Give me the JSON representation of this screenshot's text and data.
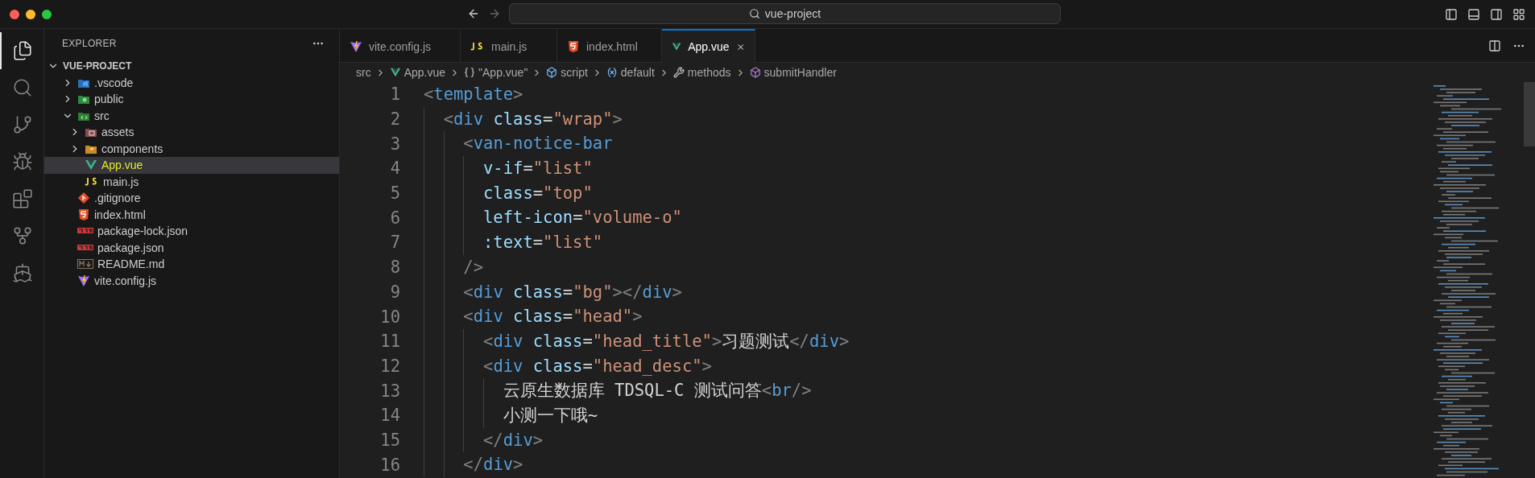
{
  "window": {
    "title": "vue-project"
  },
  "activity_bar": [
    {
      "kind": "files",
      "selected": true
    },
    {
      "kind": "search",
      "selected": false
    },
    {
      "kind": "source-control",
      "selected": false
    },
    {
      "kind": "run-debug",
      "selected": false
    },
    {
      "kind": "extensions",
      "selected": false
    },
    {
      "kind": "git-graph",
      "selected": false
    },
    {
      "kind": "docker",
      "selected": false
    }
  ],
  "sidebar": {
    "title": "EXPLORER",
    "project": {
      "label": "VUE-PROJECT",
      "expanded": true,
      "children": [
        {
          "label": ".vscode",
          "kind": "vscode-folder",
          "expanded": false,
          "selected": false
        },
        {
          "label": "public",
          "kind": "public-folder",
          "expanded": false,
          "selected": false
        },
        {
          "label": "src",
          "kind": "src-folder",
          "expanded": true,
          "selected": false,
          "children": [
            {
              "label": "assets",
              "kind": "assets-folder",
              "expanded": false,
              "selected": false
            },
            {
              "label": "components",
              "kind": "components-folder",
              "expanded": false,
              "selected": false
            },
            {
              "label": "App.vue",
              "kind": "vue",
              "selected": true
            },
            {
              "label": "main.js",
              "kind": "js",
              "selected": false
            }
          ]
        },
        {
          "label": ".gitignore",
          "kind": "git",
          "selected": false
        },
        {
          "label": "index.html",
          "kind": "html",
          "selected": false
        },
        {
          "label": "package-lock.json",
          "kind": "npm",
          "selected": false
        },
        {
          "label": "package.json",
          "kind": "npm",
          "selected": false
        },
        {
          "label": "README.md",
          "kind": "markdown",
          "selected": false
        },
        {
          "label": "vite.config.js",
          "kind": "vite",
          "selected": false
        }
      ]
    }
  },
  "tabs": [
    {
      "label": "vite.config.js",
      "kind": "vite",
      "selected": false
    },
    {
      "label": "main.js",
      "kind": "js",
      "selected": false
    },
    {
      "label": "index.html",
      "kind": "html",
      "selected": false
    },
    {
      "label": "App.vue",
      "kind": "vue",
      "selected": true
    }
  ],
  "breadcrumb": [
    {
      "label": "src",
      "kind": "folder"
    },
    {
      "label": "App.vue",
      "kind": "vue"
    },
    {
      "label": "\"App.vue\"",
      "kind": "braces"
    },
    {
      "label": "script",
      "kind": "module"
    },
    {
      "label": "default",
      "kind": "variable"
    },
    {
      "label": "methods",
      "kind": "property"
    },
    {
      "label": "submitHandler",
      "kind": "method"
    }
  ],
  "code": [
    {
      "number": "1",
      "tokens": [
        {
          "kind": "punct",
          "text": "<"
        },
        {
          "kind": "tag",
          "text": "template"
        },
        {
          "kind": "punct",
          "text": ">"
        }
      ],
      "children": [
        {
          "number": "2",
          "tokens": [
            {
              "kind": "punct",
              "text": "<"
            },
            {
              "kind": "tag",
              "text": "div"
            },
            {
              "kind": "attr",
              "text": " class"
            },
            {
              "kind": "text",
              "text": "="
            },
            {
              "kind": "string",
              "text": "\"wrap\""
            },
            {
              "kind": "punct",
              "text": ">"
            }
          ],
          "children": [
            {
              "number": "3",
              "tokens": [
                {
                  "kind": "punct",
                  "text": "<"
                },
                {
                  "kind": "tag",
                  "text": "van-notice-bar"
                }
              ],
              "children": [
                {
                  "number": "4",
                  "tokens": [
                    {
                      "kind": "attr",
                      "text": "v-if"
                    },
                    {
                      "kind": "text",
                      "text": "="
                    },
                    {
                      "kind": "string",
                      "text": "\"list\""
                    }
                  ]
                },
                {
                  "number": "5",
                  "tokens": [
                    {
                      "kind": "attr",
                      "text": "class"
                    },
                    {
                      "kind": "text",
                      "text": "="
                    },
                    {
                      "kind": "string",
                      "text": "\"top\""
                    }
                  ]
                },
                {
                  "number": "6",
                  "tokens": [
                    {
                      "kind": "attr",
                      "text": "left-icon"
                    },
                    {
                      "kind": "text",
                      "text": "="
                    },
                    {
                      "kind": "string",
                      "text": "\"volume-o\""
                    }
                  ]
                },
                {
                  "number": "7",
                  "tokens": [
                    {
                      "kind": "attr",
                      "text": ":text"
                    },
                    {
                      "kind": "text",
                      "text": "="
                    },
                    {
                      "kind": "string",
                      "text": "\"list\""
                    }
                  ]
                }
              ]
            },
            {
              "number": "8",
              "tokens": [
                {
                  "kind": "punct",
                  "text": "/>"
                }
              ]
            },
            {
              "number": "9",
              "tokens": [
                {
                  "kind": "punct",
                  "text": "<"
                },
                {
                  "kind": "tag",
                  "text": "div"
                },
                {
                  "kind": "attr",
                  "text": " class"
                },
                {
                  "kind": "text",
                  "text": "="
                },
                {
                  "kind": "string",
                  "text": "\"bg\""
                },
                {
                  "kind": "punct",
                  "text": "></"
                },
                {
                  "kind": "tag",
                  "text": "div"
                },
                {
                  "kind": "punct",
                  "text": ">"
                }
              ]
            },
            {
              "number": "10",
              "tokens": [
                {
                  "kind": "punct",
                  "text": "<"
                },
                {
                  "kind": "tag",
                  "text": "div"
                },
                {
                  "kind": "attr",
                  "text": " class"
                },
                {
                  "kind": "text",
                  "text": "="
                },
                {
                  "kind": "string",
                  "text": "\"head\""
                },
                {
                  "kind": "punct",
                  "text": ">"
                }
              ],
              "children": [
                {
                  "number": "11",
                  "tokens": [
                    {
                      "kind": "punct",
                      "text": "<"
                    },
                    {
                      "kind": "tag",
                      "text": "div"
                    },
                    {
                      "kind": "attr",
                      "text": " class"
                    },
                    {
                      "kind": "text",
                      "text": "="
                    },
                    {
                      "kind": "string",
                      "text": "\"head_title\""
                    },
                    {
                      "kind": "punct",
                      "text": ">"
                    },
                    {
                      "kind": "text",
                      "text": "习题测试"
                    },
                    {
                      "kind": "punct",
                      "text": "</"
                    },
                    {
                      "kind": "tag",
                      "text": "div"
                    },
                    {
                      "kind": "punct",
                      "text": ">"
                    }
                  ]
                },
                {
                  "number": "12",
                  "tokens": [
                    {
                      "kind": "punct",
                      "text": "<"
                    },
                    {
                      "kind": "tag",
                      "text": "div"
                    },
                    {
                      "kind": "attr",
                      "text": " class"
                    },
                    {
                      "kind": "text",
                      "text": "="
                    },
                    {
                      "kind": "string",
                      "text": "\"head_desc\""
                    },
                    {
                      "kind": "punct",
                      "text": ">"
                    }
                  ],
                  "children": [
                    {
                      "number": "13",
                      "tokens": [
                        {
                          "kind": "text",
                          "text": "云原生数据库 TDSQL-C 测试问答"
                        },
                        {
                          "kind": "punct",
                          "text": "<"
                        },
                        {
                          "kind": "tag",
                          "text": "br"
                        },
                        {
                          "kind": "punct",
                          "text": "/>"
                        }
                      ]
                    },
                    {
                      "number": "14",
                      "tokens": [
                        {
                          "kind": "text",
                          "text": "小测一下哦~"
                        }
                      ]
                    }
                  ]
                },
                {
                  "number": "15",
                  "tokens": [
                    {
                      "kind": "punct",
                      "text": "</"
                    },
                    {
                      "kind": "tag",
                      "text": "div"
                    },
                    {
                      "kind": "punct",
                      "text": ">"
                    }
                  ]
                }
              ]
            },
            {
              "number": "16",
              "tokens": [
                {
                  "kind": "punct",
                  "text": "</"
                },
                {
                  "kind": "tag",
                  "text": "div"
                },
                {
                  "kind": "punct",
                  "text": ">"
                }
              ]
            }
          ]
        }
      ]
    }
  ]
}
